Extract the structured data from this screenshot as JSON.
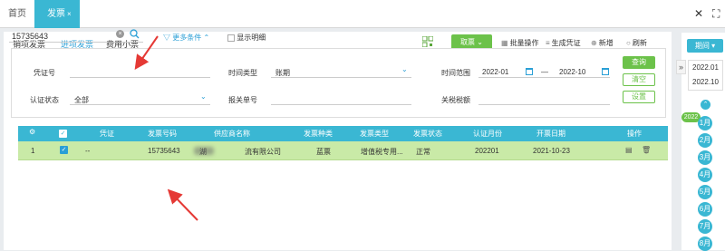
{
  "top_tabs": {
    "home": "首页",
    "invoice": "发票",
    "close": "×"
  },
  "window": {
    "close": "✕",
    "fullscreen": "⛶"
  },
  "sub_tabs": [
    "销项发票",
    "进项发票",
    "费用小票"
  ],
  "toolbar": {
    "primary": "取票",
    "batch": "批量操作",
    "voucher": "生成凭证",
    "add": "新增",
    "refresh": "刷新"
  },
  "search": {
    "value": "15735643"
  },
  "more_conditions": "更多条件",
  "show_detail": "显示明细",
  "filters": {
    "voucher_no_label": "凭证号",
    "time_type_label": "时间类型",
    "time_type_value": "账期",
    "time_range_label": "时间范围",
    "time_from": "2022-01",
    "time_dash": "—",
    "time_to": "2022-10",
    "auth_status_label": "认证状态",
    "auth_status_value": "全部",
    "customs_no_label": "报关单号",
    "customs_tax_label": "关税税额"
  },
  "buttons": {
    "query": "查询",
    "clear": "清空",
    "settings": "设置"
  },
  "table": {
    "headers": [
      "凭证",
      "发票号码",
      "供应商名称",
      "发票种类",
      "发票类型",
      "发票状态",
      "认证月份",
      "开票日期",
      "操作"
    ],
    "rows": [
      {
        "index": "1",
        "voucher": "--",
        "invoice_no": "15735643",
        "supplier_a": "湖",
        "supplier_b": "流有限公司",
        "kind": "蓝票",
        "type": "增值税专用...",
        "status": "正常",
        "auth_month": "202201",
        "issue_date": "2021-10-23"
      }
    ]
  },
  "period": {
    "button": "期间",
    "expand": "»",
    "options": [
      "2022.01",
      "2022.10"
    ],
    "year": "2022",
    "months": [
      "1月",
      "2月",
      "3月",
      "4月",
      "5月",
      "6月",
      "7月",
      "8月"
    ]
  },
  "colors": {
    "accent": "#3ab7d3",
    "green": "#6cc24a",
    "link": "#2a9fd6",
    "row_highlight": "#c9eaa7",
    "arrow": "#e53935"
  }
}
